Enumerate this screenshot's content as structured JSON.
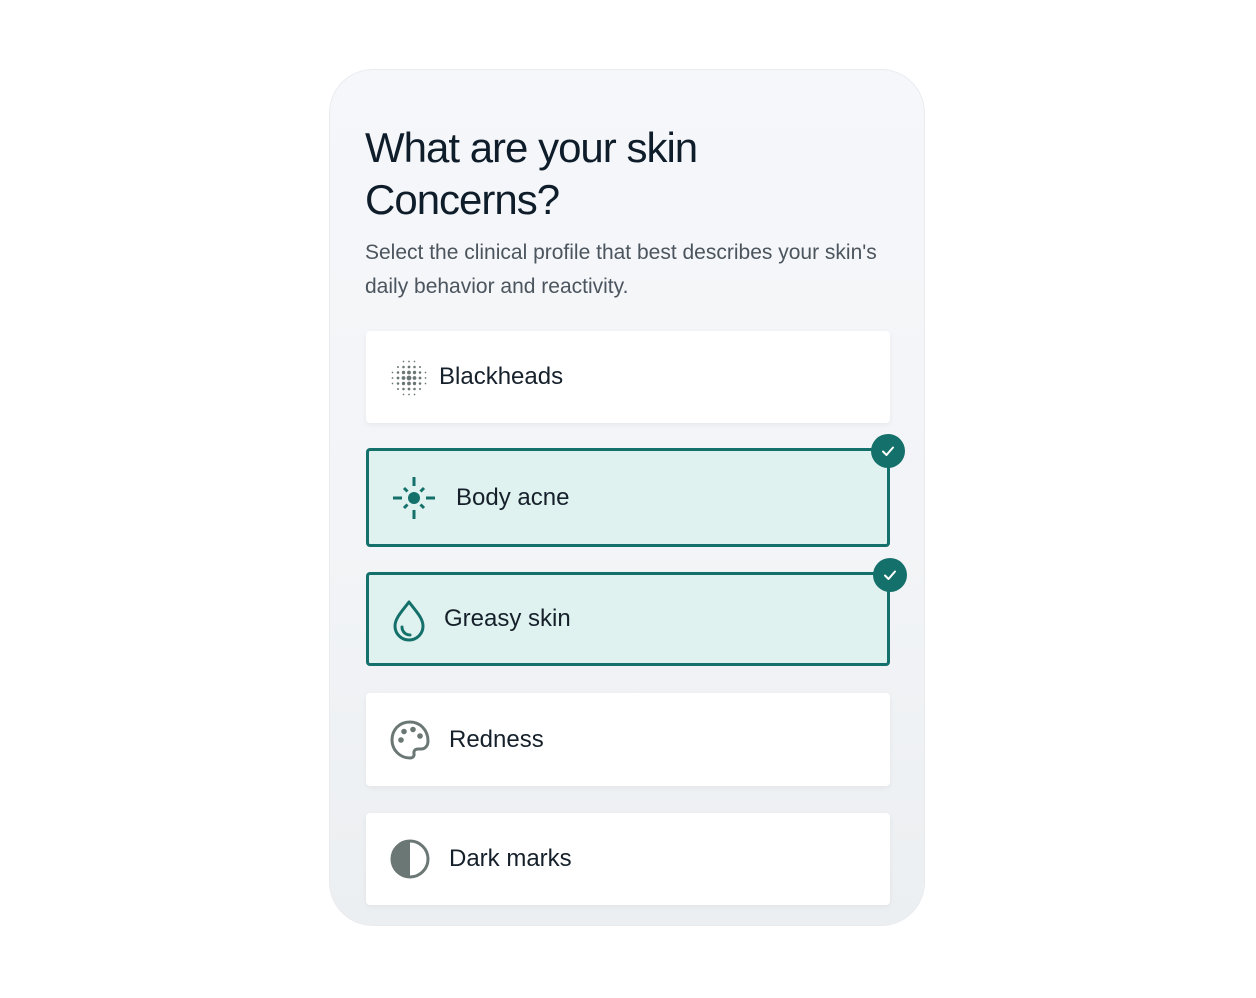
{
  "question": {
    "title": "What are your skin Concerns?",
    "subtitle": "Select the clinical profile that best describes your skin's daily behavior and reactivity."
  },
  "colors": {
    "accent": "#14706a",
    "selected_bg": "#e0f2f0",
    "icon_gray": "#6b7774",
    "title": "#0f1d2b",
    "subtitle": "#4c555e"
  },
  "options": [
    {
      "label": "Blackheads",
      "icon": "dot-grid-icon",
      "selected": false
    },
    {
      "label": "Body acne",
      "icon": "burst-icon",
      "selected": true
    },
    {
      "label": "Greasy skin",
      "icon": "droplet-icon",
      "selected": true
    },
    {
      "label": "Redness",
      "icon": "palette-icon",
      "selected": false
    },
    {
      "label": "Dark marks",
      "icon": "half-circle-icon",
      "selected": false
    }
  ]
}
